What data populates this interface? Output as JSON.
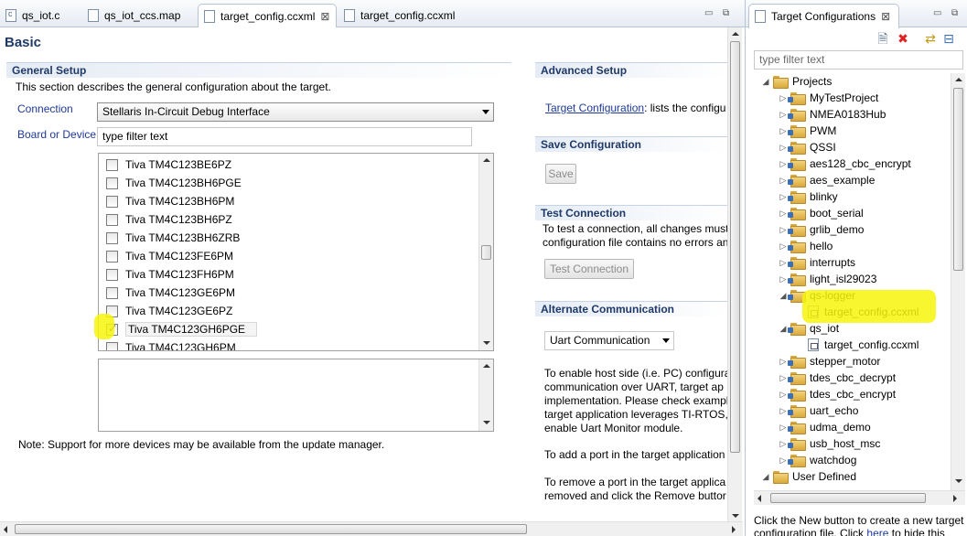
{
  "editor_tabs": [
    {
      "label": "qs_iot.c",
      "active": false
    },
    {
      "label": "qs_iot_ccs.map",
      "active": false
    },
    {
      "label": "target_config.ccxml",
      "active": true
    },
    {
      "label": "target_config.ccxml",
      "active": false
    }
  ],
  "page_title": "Basic",
  "general_setup": {
    "title": "General Setup",
    "description": "This section describes the general configuration about the target.",
    "connection_label": "Connection",
    "connection_value": "Stellaris In-Circuit Debug Interface",
    "board_label": "Board or Device",
    "filter_placeholder": "type filter text",
    "devices": [
      {
        "name": "Tiva TM4C123BE6PZ",
        "checked": false
      },
      {
        "name": "Tiva TM4C123BH6PGE",
        "checked": false
      },
      {
        "name": "Tiva TM4C123BH6PM",
        "checked": false
      },
      {
        "name": "Tiva TM4C123BH6PZ",
        "checked": false
      },
      {
        "name": "Tiva TM4C123BH6ZRB",
        "checked": false
      },
      {
        "name": "Tiva TM4C123FE6PM",
        "checked": false
      },
      {
        "name": "Tiva TM4C123FH6PM",
        "checked": false
      },
      {
        "name": "Tiva TM4C123GE6PM",
        "checked": false
      },
      {
        "name": "Tiva TM4C123GE6PZ",
        "checked": false
      },
      {
        "name": "Tiva TM4C123GH6PGE",
        "checked": true
      },
      {
        "name": "Tiva TM4C123GH6PM",
        "checked": false
      }
    ],
    "note": "Note: Support for more devices may be available from the update manager."
  },
  "advanced_setup": {
    "title": "Advanced Setup",
    "link_text": "Target Configuration",
    "link_suffix": ": lists the configu"
  },
  "save_configuration": {
    "title": "Save Configuration",
    "save_button": "Save"
  },
  "test_connection": {
    "title": "Test Connection",
    "line1": "To test a connection, all changes must",
    "line2": "configuration file contains no errors an",
    "button": "Test Connection"
  },
  "alternate_communication": {
    "title": "Alternate Communication",
    "dropdown_value": "Uart Communication",
    "para_lines": [
      "To enable host side (i.e. PC) configura",
      "communication over UART, target ap",
      "implementation. Please check exampl",
      "target application leverages TI-RTOS,",
      "enable Uart Monitor module."
    ],
    "add_line": "To add a port in the target application",
    "remove_line1": "To remove a port in the target applica",
    "remove_line2": "removed and click the Remove buttor"
  },
  "target_configurations": {
    "title": "Target Configurations",
    "filter_placeholder": "type filter text",
    "tree": [
      {
        "label": "Projects",
        "level": 0,
        "expanded": true,
        "type": "folder"
      },
      {
        "label": "MyTestProject",
        "level": 1,
        "type": "project"
      },
      {
        "label": "NMEA0183Hub",
        "level": 1,
        "type": "project"
      },
      {
        "label": "PWM",
        "level": 1,
        "type": "project"
      },
      {
        "label": "QSSI",
        "level": 1,
        "type": "project"
      },
      {
        "label": "aes128_cbc_encrypt",
        "level": 1,
        "type": "project"
      },
      {
        "label": "aes_example",
        "level": 1,
        "type": "project"
      },
      {
        "label": "blinky",
        "level": 1,
        "type": "project"
      },
      {
        "label": "boot_serial",
        "level": 1,
        "type": "project"
      },
      {
        "label": "grlib_demo",
        "level": 1,
        "type": "project"
      },
      {
        "label": "hello",
        "level": 1,
        "type": "project"
      },
      {
        "label": "interrupts",
        "level": 1,
        "type": "project"
      },
      {
        "label": "light_isl29023",
        "level": 1,
        "type": "project"
      },
      {
        "label": "qs-logger",
        "level": 1,
        "type": "project",
        "expanded": true
      },
      {
        "label": "target_config.ccxml",
        "level": 2,
        "type": "config"
      },
      {
        "label": "qs_iot",
        "level": 1,
        "type": "project",
        "expanded": true
      },
      {
        "label": "target_config.ccxml",
        "level": 2,
        "type": "config"
      },
      {
        "label": "stepper_motor",
        "level": 1,
        "type": "project"
      },
      {
        "label": "tdes_cbc_decrypt",
        "level": 1,
        "type": "project"
      },
      {
        "label": "tdes_cbc_encrypt",
        "level": 1,
        "type": "project"
      },
      {
        "label": "uart_echo",
        "level": 1,
        "type": "project"
      },
      {
        "label": "udma_demo",
        "level": 1,
        "type": "project"
      },
      {
        "label": "usb_host_msc",
        "level": 1,
        "type": "project"
      },
      {
        "label": "watchdog",
        "level": 1,
        "type": "project"
      },
      {
        "label": "User Defined",
        "level": 0,
        "expanded": true,
        "type": "folder"
      }
    ],
    "footer_line1": "Click the New button to create a new target",
    "footer_line2_pre": "configuration file. Click ",
    "footer_link": "here",
    "footer_line2_post": " to hide this"
  },
  "colors": {
    "section_title": "#1f3a68",
    "link": "#1f3a9a",
    "highlight": "#f6f40a"
  }
}
